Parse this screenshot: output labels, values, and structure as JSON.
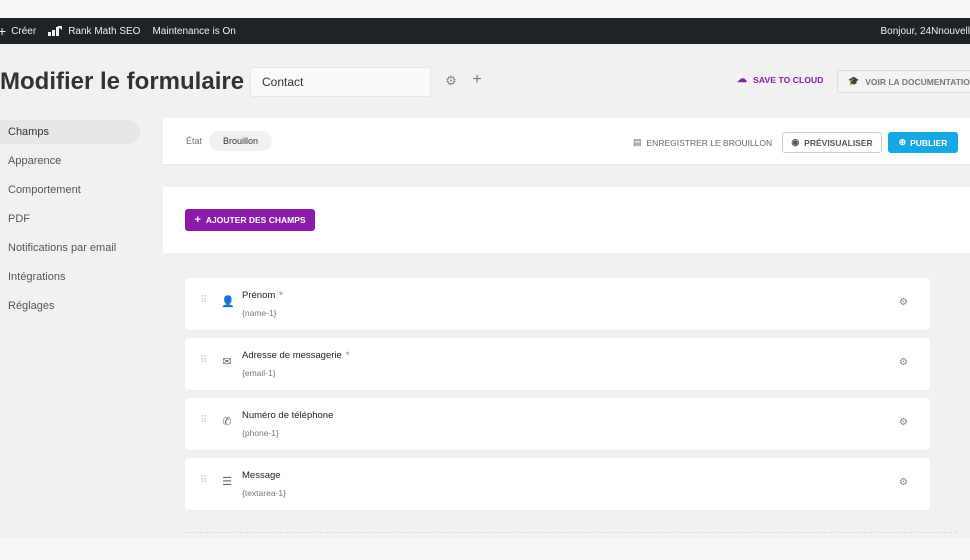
{
  "admin_bar": {
    "create": "Créer",
    "seo": "Rank Math SEO",
    "maintenance": "Maintenance is On",
    "greeting": "Bonjour, 24Nnouvell"
  },
  "header": {
    "title": "Modifier le formulaire",
    "form_name": "Contact",
    "save_cloud": "SAVE TO CLOUD",
    "doc_button": "VOIR LA DOCUMENTATION"
  },
  "sidebar": {
    "items": [
      {
        "label": "Champs",
        "active": true
      },
      {
        "label": "Apparence"
      },
      {
        "label": "Comportement"
      },
      {
        "label": "PDF"
      },
      {
        "label": "Notifications par email"
      },
      {
        "label": "Intégrations"
      },
      {
        "label": "Réglages"
      }
    ]
  },
  "statusbar": {
    "etat_label": "État",
    "etat_value": "Brouillon",
    "save_draft": "ENREGISTRER LE BROUILLON",
    "preview": "PRÉVISUALISER",
    "publish": "PUBLIER"
  },
  "add_fields": {
    "label": "AJOUTER DES CHAMPS"
  },
  "fields": [
    {
      "label": "Prénom",
      "required": "*",
      "key": "{name-1}",
      "icon": "user-icon"
    },
    {
      "label": "Adresse de messagerie",
      "required": "*",
      "key": "{email-1}",
      "icon": "envelope-icon"
    },
    {
      "label": "Numéro de téléphone",
      "required": "",
      "key": "{phone-1}",
      "icon": "phone-icon"
    },
    {
      "label": "Message",
      "required": "",
      "key": "{textarea-1}",
      "icon": "textarea-icon"
    }
  ],
  "colors": {
    "accent_purple": "#8c1ca8",
    "publish_blue": "#17a8e3",
    "admin_bar": "#1d2327",
    "required_red": "#ee4444"
  }
}
